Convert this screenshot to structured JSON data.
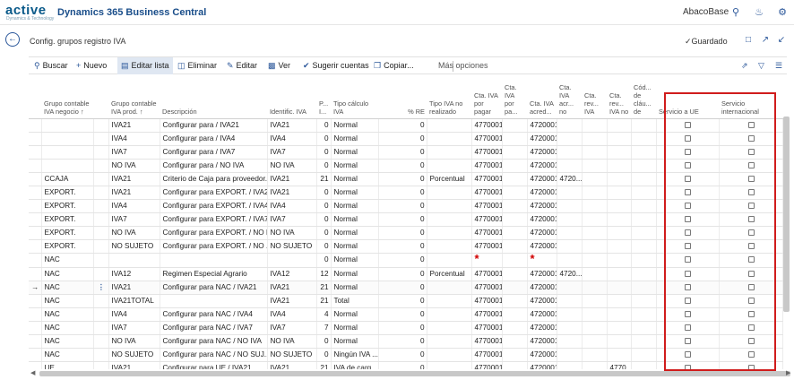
{
  "app": {
    "logo": "active",
    "logo_sub": "Dynamics & Technology",
    "name": "Dynamics 365 Business Central",
    "company": "AbacoBase"
  },
  "page": {
    "title": "Config. grupos registro IVA",
    "saved": "✓Guardado"
  },
  "actions": {
    "search": "Buscar",
    "new": "Nuevo",
    "edit_list": "Editar lista",
    "delete": "Eliminar",
    "edit": "Editar",
    "view": "Ver",
    "suggest": "Sugerir cuentas",
    "copy": "Copiar...",
    "more": "Más opciones"
  },
  "columns": {
    "c1": "Grupo contable IVA negocio ↑",
    "c2": "Grupo contable IVA prod. ↑",
    "c3": "Descripción",
    "c4": "Identific. IVA",
    "c5": "P... I...",
    "c6": "Tipo cálculo IVA",
    "c7": "% RE",
    "c8": "Tipo IVA no realizado",
    "c9": "Cta. IVA por pagar",
    "c10": "Cta. IVA por pa...",
    "c11": "Cta. IVA acred...",
    "c12": "Cta. IVA acr... no",
    "c13": "Cta. rev... IVA",
    "c14": "Cta. rev... IVA no",
    "c15": "Cód... de cláu... de",
    "c16": "Servicio a UE",
    "c17": "Servicio internacional"
  },
  "rows": [
    {
      "neg": "",
      "prod": "IVA21",
      "desc": "Configurar para  / IVA21",
      "id": "IVA21",
      "pct": "0",
      "calc": "Normal",
      "re": "0",
      "nr": "",
      "pagar": "4770001",
      "acred": "4720001",
      "acrno": "",
      "rev": ""
    },
    {
      "neg": "",
      "prod": "IVA4",
      "desc": "Configurar para  / IVA4",
      "id": "IVA4",
      "pct": "0",
      "calc": "Normal",
      "re": "0",
      "nr": "",
      "pagar": "4770001",
      "acred": "4720001",
      "acrno": "",
      "rev": ""
    },
    {
      "neg": "",
      "prod": "IVA7",
      "desc": "Configurar para  / IVA7",
      "id": "IVA7",
      "pct": "0",
      "calc": "Normal",
      "re": "0",
      "nr": "",
      "pagar": "4770001",
      "acred": "4720001",
      "acrno": "",
      "rev": ""
    },
    {
      "neg": "",
      "prod": "NO IVA",
      "desc": "Configurar para  / NO IVA",
      "id": "NO IVA",
      "pct": "0",
      "calc": "Normal",
      "re": "0",
      "nr": "",
      "pagar": "4770001",
      "acred": "4720001",
      "acrno": "",
      "rev": ""
    },
    {
      "neg": "CCAJA",
      "prod": "IVA21",
      "desc": "Criterio de Caja para proveedor...",
      "id": "IVA21",
      "pct": "21",
      "calc": "Normal",
      "re": "0",
      "nr": "Porcentual",
      "pagar": "4770001",
      "acred": "4720001",
      "acrno": "4720...",
      "rev": ""
    },
    {
      "neg": "EXPORT.",
      "prod": "IVA21",
      "desc": "Configurar para EXPORT. / IVA21",
      "id": "IVA21",
      "pct": "0",
      "calc": "Normal",
      "re": "0",
      "nr": "",
      "pagar": "4770001",
      "acred": "4720001",
      "acrno": "",
      "rev": ""
    },
    {
      "neg": "EXPORT.",
      "prod": "IVA4",
      "desc": "Configurar para EXPORT. / IVA4",
      "id": "IVA4",
      "pct": "0",
      "calc": "Normal",
      "re": "0",
      "nr": "",
      "pagar": "4770001",
      "acred": "4720001",
      "acrno": "",
      "rev": ""
    },
    {
      "neg": "EXPORT.",
      "prod": "IVA7",
      "desc": "Configurar para EXPORT. / IVA7",
      "id": "IVA7",
      "pct": "0",
      "calc": "Normal",
      "re": "0",
      "nr": "",
      "pagar": "4770001",
      "acred": "4720001",
      "acrno": "",
      "rev": ""
    },
    {
      "neg": "EXPORT.",
      "prod": "NO IVA",
      "desc": "Configurar para EXPORT. / NO I...",
      "id": "NO IVA",
      "pct": "0",
      "calc": "Normal",
      "re": "0",
      "nr": "",
      "pagar": "4770001",
      "acred": "4720001",
      "acrno": "",
      "rev": ""
    },
    {
      "neg": "EXPORT.",
      "prod": "NO SUJETO",
      "desc": "Configurar para EXPORT. / NO ...",
      "id": "NO SUJETO",
      "pct": "0",
      "calc": "Normal",
      "re": "0",
      "nr": "",
      "pagar": "4770001",
      "acred": "4720001",
      "acrno": "",
      "rev": ""
    },
    {
      "neg": "NAC",
      "prod": "",
      "desc": "",
      "id": "",
      "pct": "0",
      "calc": "Normal",
      "re": "0",
      "nr": "",
      "pagar": "*",
      "acred": "*",
      "acrno": "",
      "rev": ""
    },
    {
      "neg": "NAC",
      "prod": "IVA12",
      "desc": "Regimen Especial Agrario",
      "id": "IVA12",
      "pct": "12",
      "calc": "Normal",
      "re": "0",
      "nr": "Porcentual",
      "pagar": "4770001",
      "acred": "4720001",
      "acrno": "4720...",
      "rev": ""
    },
    {
      "neg": "NAC",
      "prod": "IVA21",
      "desc": "Configurar para NAC / IVA21",
      "id": "IVA21",
      "pct": "21",
      "calc": "Normal",
      "re": "0",
      "nr": "",
      "pagar": "4770001",
      "acred": "4720001",
      "acrno": "",
      "rev": ""
    },
    {
      "neg": "NAC",
      "prod": "IVA21TOTAL",
      "desc": "",
      "id": "IVA21",
      "pct": "21",
      "calc": "Total",
      "re": "0",
      "nr": "",
      "pagar": "4770001",
      "acred": "4720001",
      "acrno": "",
      "rev": ""
    },
    {
      "neg": "NAC",
      "prod": "IVA4",
      "desc": "Configurar para NAC / IVA4",
      "id": "IVA4",
      "pct": "4",
      "calc": "Normal",
      "re": "0",
      "nr": "",
      "pagar": "4770001",
      "acred": "4720001",
      "acrno": "",
      "rev": ""
    },
    {
      "neg": "NAC",
      "prod": "IVA7",
      "desc": "Configurar para NAC / IVA7",
      "id": "IVA7",
      "pct": "7",
      "calc": "Normal",
      "re": "0",
      "nr": "",
      "pagar": "4770001",
      "acred": "4720001",
      "acrno": "",
      "rev": ""
    },
    {
      "neg": "NAC",
      "prod": "NO IVA",
      "desc": "Configurar para NAC / NO IVA",
      "id": "NO IVA",
      "pct": "0",
      "calc": "Normal",
      "re": "0",
      "nr": "",
      "pagar": "4770001",
      "acred": "4720001",
      "acrno": "",
      "rev": ""
    },
    {
      "neg": "NAC",
      "prod": "NO SUJETO",
      "desc": "Configurar para NAC / NO SUJ...",
      "id": "NO SUJETO",
      "pct": "0",
      "calc": "Ningún IVA ...",
      "re": "0",
      "nr": "",
      "pagar": "4770001",
      "acred": "4720001",
      "acrno": "",
      "rev": ""
    },
    {
      "neg": "UE",
      "prod": "IVA21",
      "desc": "Configurar para UE / IVA21",
      "id": "IVA21",
      "pct": "21",
      "calc": "IVA de carg...",
      "re": "0",
      "nr": "",
      "pagar": "4770001",
      "acred": "4720001",
      "acrno": "",
      "rev": "4770..."
    }
  ]
}
